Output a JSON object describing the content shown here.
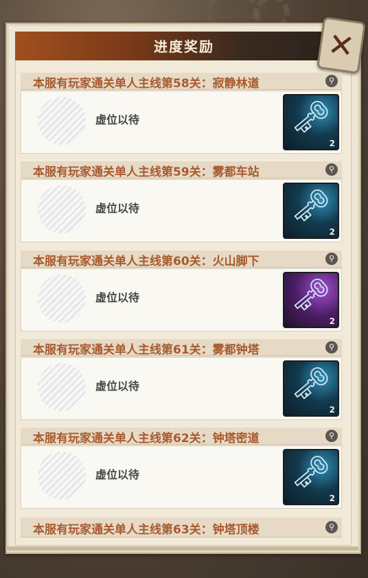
{
  "header": {
    "title": "进度奖励"
  },
  "close_button": {
    "symbol": "✕"
  },
  "rewards": [
    {
      "title": "本服有玩家通关单人主线第58关：寂静林道",
      "status": "虚位以待",
      "item_count": "2",
      "item_rarity": "blue"
    },
    {
      "title": "本服有玩家通关单人主线第59关：雾都车站",
      "status": "虚位以待",
      "item_count": "2",
      "item_rarity": "blue"
    },
    {
      "title": "本服有玩家通关单人主线第60关：火山脚下",
      "status": "虚位以待",
      "item_count": "2",
      "item_rarity": "purple"
    },
    {
      "title": "本服有玩家通关单人主线第61关：雾都钟塔",
      "status": "虚位以待",
      "item_count": "2",
      "item_rarity": "blue"
    },
    {
      "title": "本服有玩家通关单人主线第62关：钟塔密道",
      "status": "虚位以待",
      "item_count": "2",
      "item_rarity": "blue"
    },
    {
      "title": "本服有玩家通关单人主线第63关：钟塔顶楼"
    }
  ],
  "icons": {
    "search": "magnifier-icon",
    "key": "key-icon",
    "close": "close-icon"
  },
  "colors": {
    "title_text": "#a85a2e",
    "header_bg": "#a04f1f",
    "blue_item": "#2f8fb5",
    "purple_item": "#a24fd0"
  }
}
